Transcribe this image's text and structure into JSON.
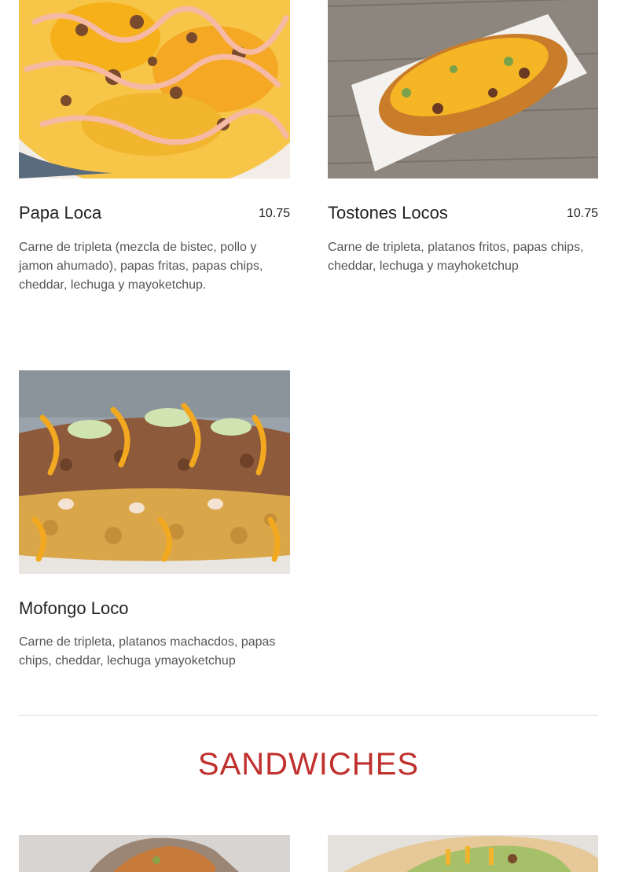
{
  "items": [
    {
      "name": "Papa Loca",
      "price": "10.75",
      "description": "Carne de tripleta (mezcla de bistec, pollo y jamon ahumado), papas fritas, papas chips, cheddar, lechuga y mayoketchup."
    },
    {
      "name": "Tostones Locos",
      "price": "10.75",
      "description": "Carne de tripleta, platanos fritos, papas chips, cheddar, lechuga y mayhoketchup"
    },
    {
      "name": "Mofongo Loco",
      "price": "",
      "description": "Carne de tripleta, platanos machacdos, papas chips, cheddar, lechuga ymayoketchup"
    }
  ],
  "section": {
    "title": "SANDWICHES"
  },
  "colors": {
    "accent": "#c0302d",
    "text": "#222222",
    "muted": "#555555",
    "divider": "#dcdcdc"
  }
}
